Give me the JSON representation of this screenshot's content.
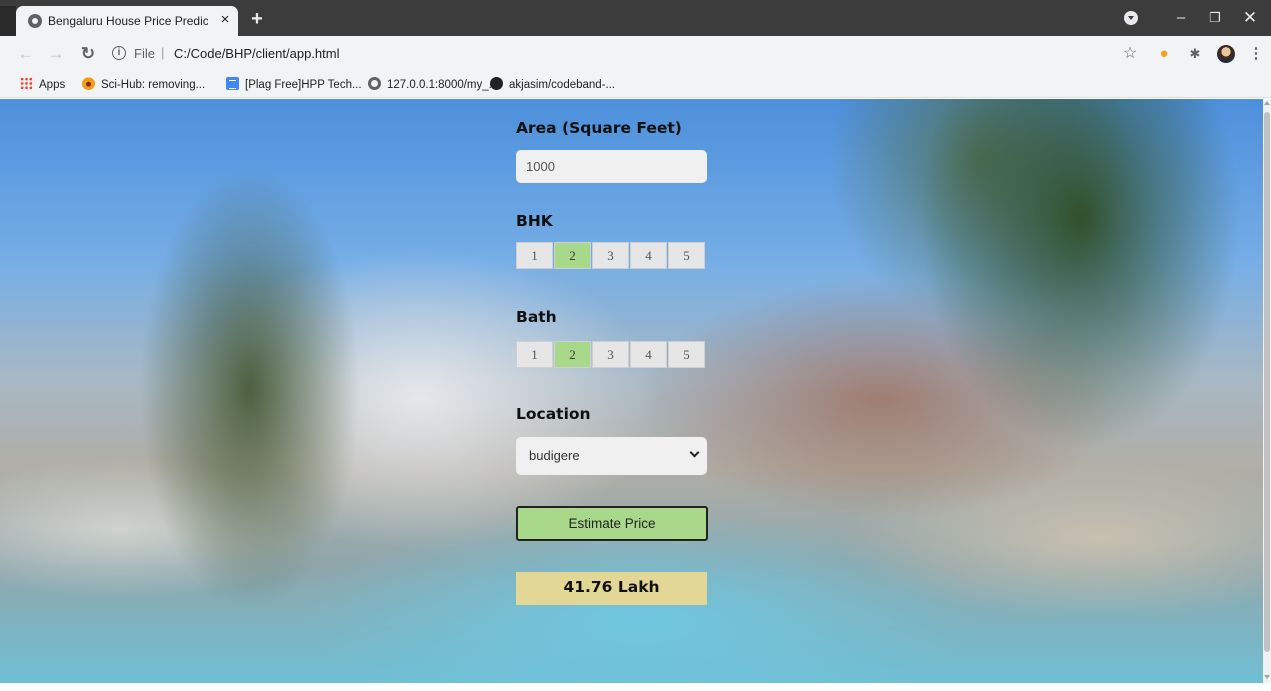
{
  "browser": {
    "tab_title": "Bengaluru House Price Prediction",
    "tab_close": "×",
    "new_tab": "+",
    "url_scheme": "File",
    "url_separator": "|",
    "url": "C:/Code/BHP/client/app.html",
    "icons": [
      "back-icon",
      "forward-icon",
      "reload-icon",
      "info-icon",
      "star-icon",
      "extension-icon",
      "puzzle-icon",
      "menu-dots-icon"
    ]
  },
  "bookmarks": [
    {
      "label": "Apps",
      "icon": "apps-grid-icon"
    },
    {
      "label": "Sci-Hub: removing...",
      "icon": "sci-hub-icon"
    },
    {
      "label": "[Plag Free]HPP Tech...",
      "icon": "docs-icon"
    },
    {
      "label": "127.0.0.1:8000/my_...",
      "icon": "globe-icon"
    },
    {
      "label": "akjasim/codeband-...",
      "icon": "github-icon"
    }
  ],
  "form": {
    "area_label": "Area (Square Feet)",
    "area_value": "1000",
    "bhk_label": "BHK",
    "bhk_options": [
      "1",
      "2",
      "3",
      "4",
      "5"
    ],
    "bhk_selected": "2",
    "bath_label": "Bath",
    "bath_options": [
      "1",
      "2",
      "3",
      "4",
      "5"
    ],
    "bath_selected": "2",
    "location_label": "Location",
    "location_value": "budigere",
    "estimate_button": "Estimate Price",
    "estimated_price": "41.76 Lakh"
  },
  "colors": {
    "selected_option": "#a8d98a",
    "button_bg": "#a8d98a",
    "price_bg": "#e2d794",
    "tabstrip": "#3c3c3c",
    "toolbar": "#f1f3f4"
  }
}
